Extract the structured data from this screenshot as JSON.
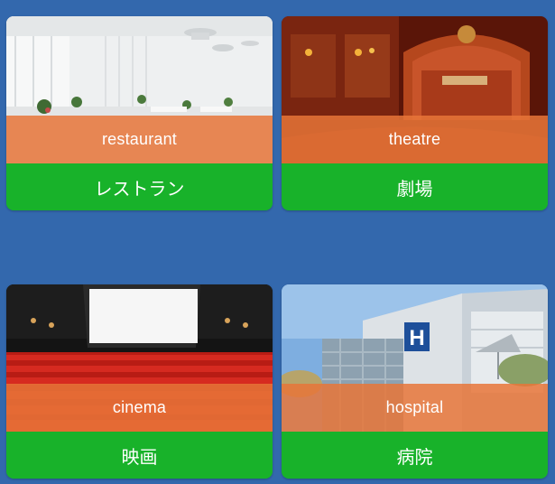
{
  "cards": [
    {
      "english": "restaurant",
      "japanese": "レストラン"
    },
    {
      "english": "theatre",
      "japanese": "劇場"
    },
    {
      "english": "cinema",
      "japanese": "映画"
    },
    {
      "english": "hospital",
      "japanese": "病院"
    }
  ],
  "colors": {
    "background": "#3368ad",
    "english_band": "#e87638",
    "japanese_band": "#18b22a",
    "text": "#ffffff"
  }
}
